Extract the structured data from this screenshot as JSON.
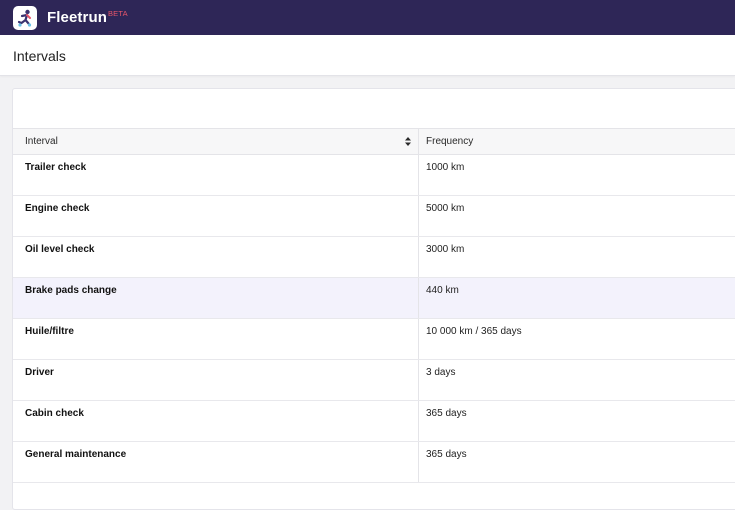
{
  "app": {
    "name": "Fleetrun",
    "badge": "BETA"
  },
  "page": {
    "title": "Intervals"
  },
  "table": {
    "columns": [
      {
        "label": "Interval",
        "sort": "sortable"
      },
      {
        "label": "Frequency"
      }
    ],
    "rows": [
      {
        "interval": "Trailer check",
        "frequency": "1000 km"
      },
      {
        "interval": "Engine check",
        "frequency": "5000 km"
      },
      {
        "interval": "Oil level check",
        "frequency": "3000 km"
      },
      {
        "interval": "Brake pads change",
        "frequency": "440 km"
      },
      {
        "interval": "Huile/filtre",
        "frequency": "10 000 km / 365 days"
      },
      {
        "interval": "Driver",
        "frequency": "3 days"
      },
      {
        "interval": "Cabin check",
        "frequency": "365 days"
      },
      {
        "interval": "General maintenance",
        "frequency": "365 days"
      }
    ],
    "highlighted_row": 3
  },
  "colors": {
    "topbar": "#2e2657",
    "beta_badge": "#e8566a",
    "row_highlight": "#f3f2fc"
  },
  "icons": {
    "logo": "fleetrun-logo-icon",
    "sort": "sort-icon"
  }
}
